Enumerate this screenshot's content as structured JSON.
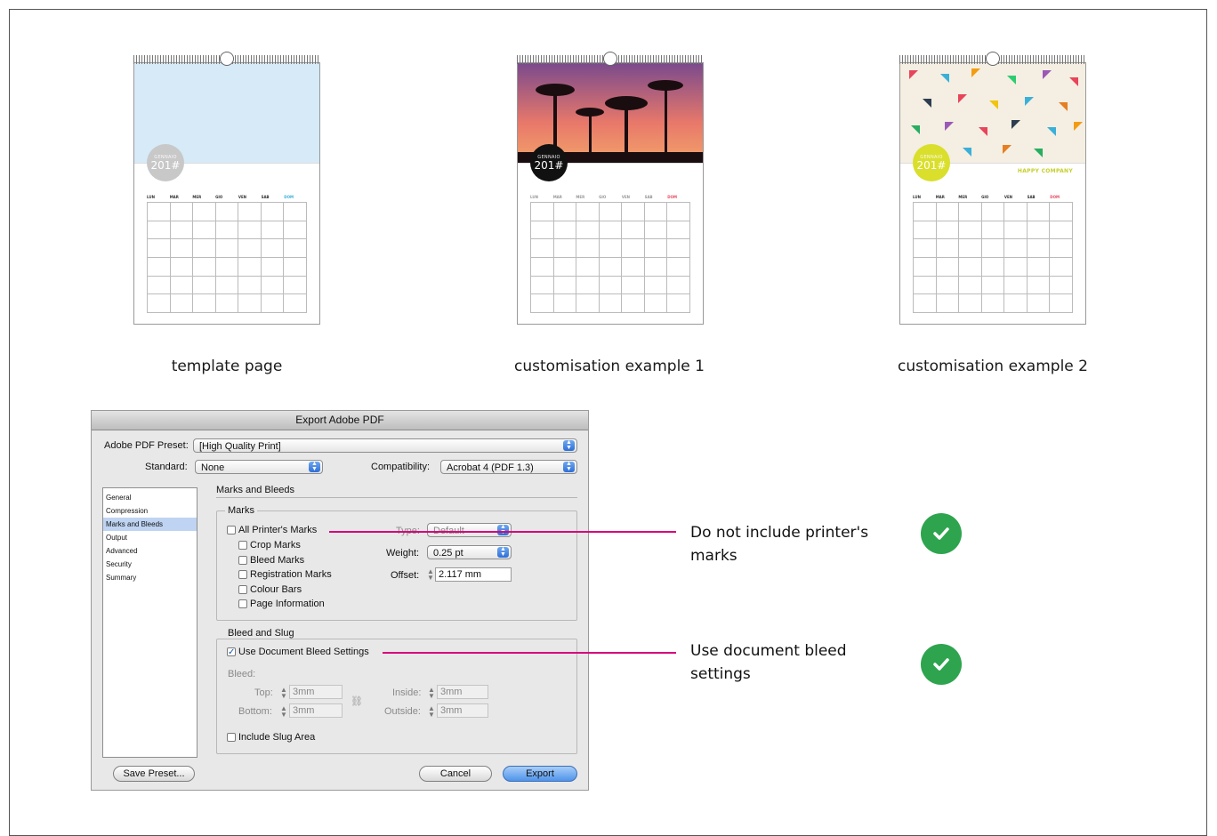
{
  "captions": {
    "template": "template page",
    "example1": "customisation example 1",
    "example2": "customisation example 2"
  },
  "calendars": [
    {
      "month": "GENNAIO",
      "year": "201#",
      "band_color": "#d6eaf8",
      "circle_color": "#c8c8c8",
      "brand": ""
    },
    {
      "month": "GENNAIO",
      "year": "201#",
      "band_color": "#e8786a",
      "circle_color": "#111111",
      "brand": ""
    },
    {
      "month": "GENNAIO",
      "year": "201#",
      "band_color": "#f4efe2",
      "circle_color": "#d9df2b",
      "brand": "HAPPY COMPANY"
    }
  ],
  "weekdays": [
    "LUN",
    "MAR",
    "MER",
    "GIO",
    "VEN",
    "SAB",
    "DOM"
  ],
  "dialog": {
    "title": "Export Adobe PDF",
    "preset_label": "Adobe PDF Preset:",
    "preset_value": "[High Quality Print]",
    "standard_label": "Standard:",
    "standard_value": "None",
    "compat_label": "Compatibility:",
    "compat_value": "Acrobat 4 (PDF 1.3)",
    "sidebar": [
      "General",
      "Compression",
      "Marks and Bleeds",
      "Output",
      "Advanced",
      "Security",
      "Summary"
    ],
    "section_title": "Marks and Bleeds",
    "marks": {
      "group_label": "Marks",
      "all": "All Printer's Marks",
      "crop": "Crop Marks",
      "bleed": "Bleed Marks",
      "registration": "Registration Marks",
      "colour": "Colour Bars",
      "page_info": "Page Information",
      "type_label": "Type:",
      "type_value": "Default",
      "weight_label": "Weight:",
      "weight_value": "0.25 pt",
      "offset_label": "Offset:",
      "offset_value": "2.117 mm"
    },
    "bleed": {
      "group_label": "Bleed and Slug",
      "use_doc": "Use Document Bleed Settings",
      "bleed_label": "Bleed:",
      "top_label": "Top:",
      "top_value": "3mm",
      "bottom_label": "Bottom:",
      "bottom_value": "3mm",
      "inside_label": "Inside:",
      "inside_value": "3mm",
      "outside_label": "Outside:",
      "outside_value": "3mm",
      "slug": "Include Slug Area"
    },
    "save_preset": "Save Preset...",
    "cancel": "Cancel",
    "export": "Export"
  },
  "notes": {
    "marks_line1": "Do not include printer's",
    "marks_line2": "marks",
    "bleed_line1": "Use document bleed",
    "bleed_line2": "settings"
  },
  "colors": {
    "leader": "#d6007b",
    "check": "#2ea44f"
  },
  "icons": {
    "check": "check-circle-icon",
    "link": "chain-link-icon"
  }
}
